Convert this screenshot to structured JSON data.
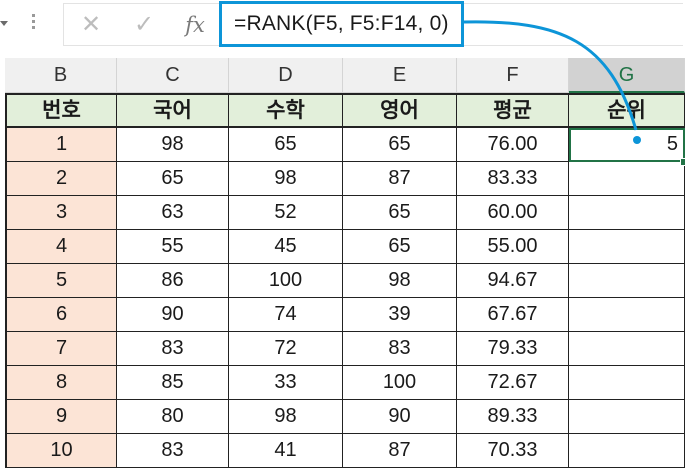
{
  "formula_bar": {
    "cancel_icon": "✕",
    "enter_icon": "✓",
    "fx_label": "fx",
    "formula": "=RANK(F5, F5:F14, 0)"
  },
  "columns": [
    "B",
    "C",
    "D",
    "E",
    "F",
    "G"
  ],
  "selected_column": "G",
  "table": {
    "headers": [
      "번호",
      "국어",
      "수학",
      "영어",
      "평균",
      "순위"
    ],
    "rows": [
      [
        "1",
        "98",
        "65",
        "65",
        "76.00",
        "5"
      ],
      [
        "2",
        "65",
        "98",
        "87",
        "83.33",
        ""
      ],
      [
        "3",
        "63",
        "52",
        "65",
        "60.00",
        ""
      ],
      [
        "4",
        "55",
        "45",
        "65",
        "55.00",
        ""
      ],
      [
        "5",
        "86",
        "100",
        "98",
        "94.67",
        ""
      ],
      [
        "6",
        "90",
        "74",
        "39",
        "67.67",
        ""
      ],
      [
        "7",
        "83",
        "72",
        "83",
        "79.33",
        ""
      ],
      [
        "8",
        "85",
        "33",
        "100",
        "72.67",
        ""
      ],
      [
        "9",
        "80",
        "98",
        "90",
        "89.33",
        ""
      ],
      [
        "10",
        "83",
        "41",
        "87",
        "70.33",
        ""
      ]
    ]
  },
  "colors": {
    "accent_callout": "#0d95d8",
    "header_fill": "#e2efda",
    "number_fill": "#fce4d6",
    "selection": "#217346"
  }
}
